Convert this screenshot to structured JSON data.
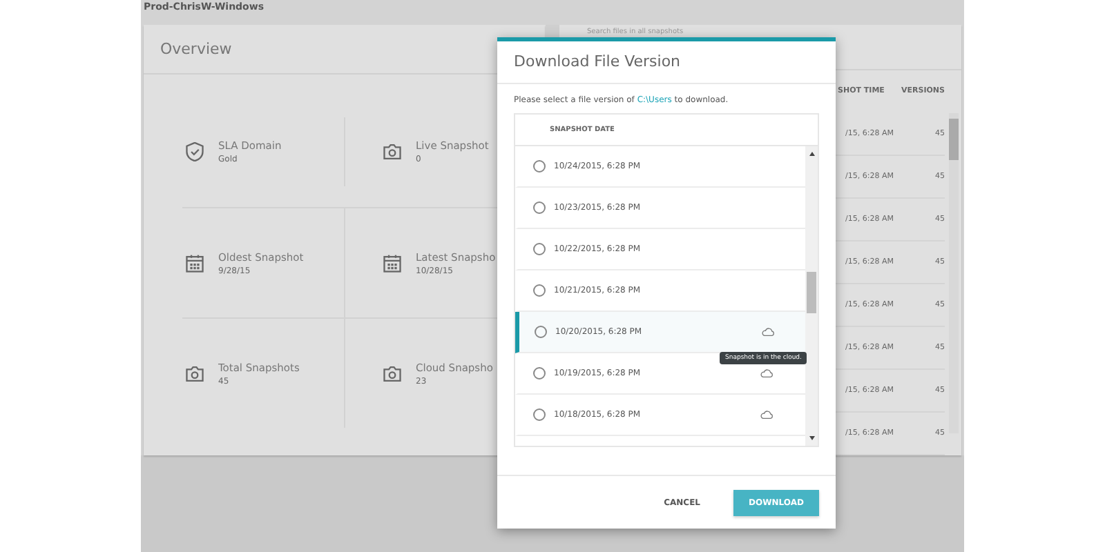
{
  "header": {
    "title": "Prod-ChrisW-Windows"
  },
  "overview": {
    "title": "Overview",
    "stats": [
      {
        "kind": "shield",
        "label": "SLA Domain",
        "value": "Gold"
      },
      {
        "kind": "camera",
        "label": "Live Snapshot",
        "value": "0"
      },
      {
        "kind": "calendar",
        "label": "Oldest Snapshot",
        "value": "9/28/15"
      },
      {
        "kind": "calendar",
        "label": "Latest Snapsho",
        "value": "10/28/15"
      },
      {
        "kind": "camera",
        "label": "Total Snapshots",
        "value": "45"
      },
      {
        "kind": "camera",
        "label": "Cloud Snapsho",
        "value": "23"
      }
    ]
  },
  "files_panel": {
    "search": {
      "placeholder": "Search files in all snapshots"
    },
    "columns": [
      "SHOT TIME",
      "VERSIONS"
    ],
    "rows": [
      [
        "/15, 6:28 AM",
        "45"
      ],
      [
        "/15, 6:28 AM",
        "45"
      ],
      [
        "/15, 6:28 AM",
        "45"
      ],
      [
        "/15, 6:28 AM",
        "45"
      ],
      [
        "/15, 6:28 AM",
        "45"
      ],
      [
        "/15, 6:28 AM",
        "45"
      ],
      [
        "/15, 6:28 AM",
        "45"
      ],
      [
        "/15, 6:28 AM",
        "45"
      ]
    ]
  },
  "dialog": {
    "title": "Download File Version",
    "prompt_before": "Please select a file version of ",
    "path_link": "C:\\Users",
    "prompt_after": " to download.",
    "list_header": "SNAPSHOT DATE",
    "versions": [
      {
        "date": "10/24/2015, 6:28 PM",
        "selected": false,
        "in_cloud": false
      },
      {
        "date": "10/23/2015, 6:28 PM",
        "selected": false,
        "in_cloud": false
      },
      {
        "date": "10/22/2015, 6:28 PM",
        "selected": false,
        "in_cloud": false
      },
      {
        "date": "10/21/2015, 6:28 PM",
        "selected": false,
        "in_cloud": false
      },
      {
        "date": "10/20/2015, 6:28 PM",
        "selected": true,
        "in_cloud": true
      },
      {
        "date": "10/19/2015, 6:28 PM",
        "selected": false,
        "in_cloud": true
      },
      {
        "date": "10/18/2015, 6:28 PM",
        "selected": false,
        "in_cloud": true
      }
    ],
    "tooltip": "Snapshot is in the cloud.",
    "buttons": [
      {
        "kind": "secondary",
        "label": "CANCEL"
      },
      {
        "kind": "primary",
        "label": "DOWNLOAD"
      }
    ]
  }
}
